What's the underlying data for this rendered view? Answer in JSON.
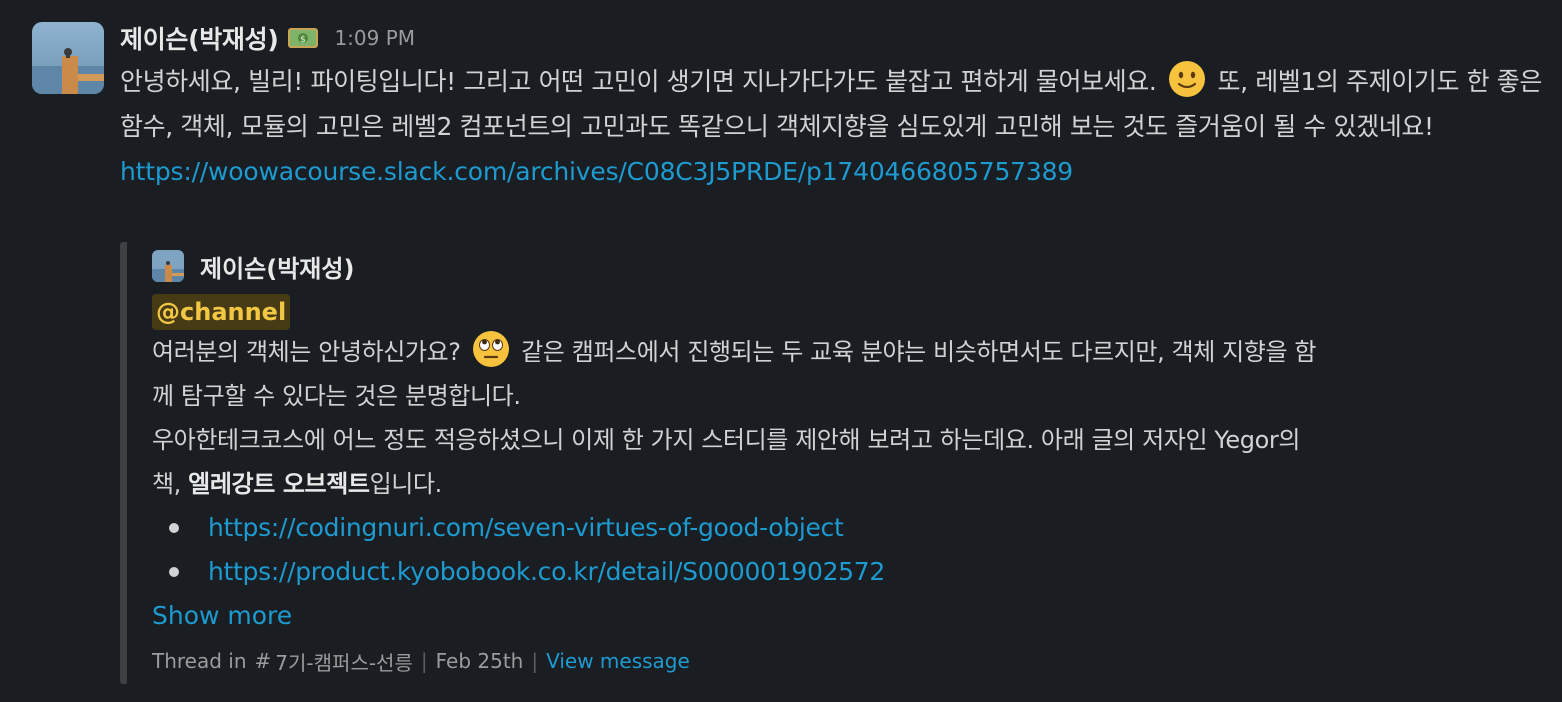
{
  "message": {
    "author": "제이슨(박재성)",
    "status_icon": "money-emoji",
    "timestamp": "1:09 PM",
    "text_part1": "안녕하세요, 빌리! 파이팅입니다! 그리고 어떤 고민이 생기면 지나가다가도 붙잡고 편하게 물어보세요.",
    "emoji_1": "slightly-smiling-face-icon",
    "text_part2": "또, 레벨1의 주제이기도 한 좋은 함수, 객체, 모듈의 고민은 레벨2 컴포넌트의 고민과도 똑같으니 객체지향을 심도있게 고민해 보는 것도 즐거움이 될 수 있겠네요!",
    "link": "https://woowacourse.slack.com/archives/C08C3J5PRDE/p1740466805757389"
  },
  "unfurl": {
    "author": "제이슨(박재성)",
    "mention": "@channel",
    "line1a": "여러분의 객체는 안녕하신가요?",
    "emoji_2": "face-with-rolling-eyes-icon",
    "line1b": "같은 캠퍼스에서 진행되는 두 교육 분야는 비슷하면서도 다르지만, 객체 지향을 함께 탐구할 수 있다는 것은 분명합니다.",
    "line2a": "우아한테크코스에 어느 정도 적응하셨으니 이제 한 가지 스터디를 제안해 보려고 하는데요. 아래 글의 저자인 Yegor의 책,",
    "line2_bold": "엘레강트 오브젝트",
    "line2b": "입니다.",
    "links": [
      "https://codingnuri.com/seven-virtues-of-good-object",
      "https://product.kyobobook.co.kr/detail/S000001902572"
    ],
    "show_more": "Show more",
    "footer": {
      "thread_in": "Thread in",
      "channel": "7기-캠퍼스-선릉",
      "date": "Feb 25th",
      "view_message": "View message"
    }
  },
  "colors": {
    "background": "#1a1d21",
    "link": "#1d9bd1",
    "mention_bg": "#473b16",
    "mention_text": "#f2c744"
  }
}
